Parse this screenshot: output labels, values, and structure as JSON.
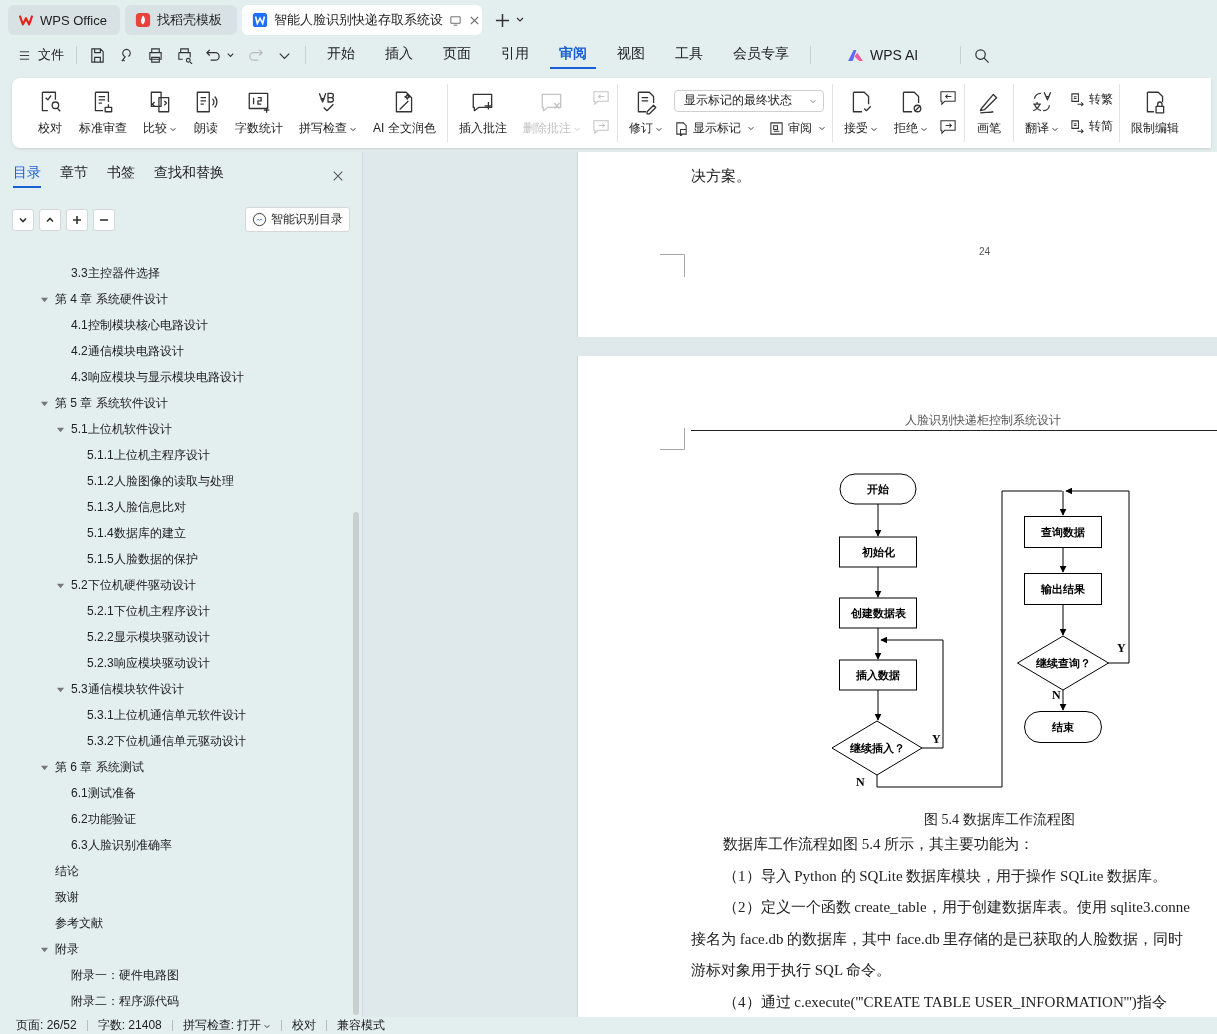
{
  "tabs": [
    {
      "label": "WPS Office",
      "selected": false
    },
    {
      "label": "找稻壳模板",
      "selected": false
    },
    {
      "label": "智能人脸识别快递存取系统设",
      "selected": true
    }
  ],
  "menu": {
    "file": "文件",
    "ai": "WPS AI",
    "tabs": [
      {
        "label": "开始",
        "selected": false
      },
      {
        "label": "插入",
        "selected": false
      },
      {
        "label": "页面",
        "selected": false
      },
      {
        "label": "引用",
        "selected": false
      },
      {
        "label": "审阅",
        "selected": true
      },
      {
        "label": "视图",
        "selected": false
      },
      {
        "label": "工具",
        "selected": false
      },
      {
        "label": "会员专享",
        "selected": false
      }
    ]
  },
  "ribbon": [
    {
      "items": [
        {
          "kind": "large",
          "label": "校对",
          "dropdown": false,
          "disabled": false
        },
        {
          "kind": "large",
          "label": "标准审查",
          "dropdown": false,
          "disabled": false
        },
        {
          "kind": "large",
          "label": "比较",
          "dropdown": true,
          "disabled": false
        },
        {
          "kind": "large",
          "label": "朗读",
          "dropdown": false,
          "disabled": false
        },
        {
          "kind": "large",
          "label": "字数统计",
          "dropdown": false,
          "disabled": false
        },
        {
          "kind": "large",
          "label": "拼写检查",
          "dropdown": true,
          "disabled": false
        },
        {
          "kind": "large",
          "label": "AI 全文润色",
          "dropdown": false,
          "disabled": false
        }
      ]
    },
    {
      "items": [
        {
          "kind": "large",
          "label": "插入批注",
          "dropdown": false,
          "disabled": false
        },
        {
          "kind": "large",
          "label": "删除批注",
          "dropdown": true,
          "disabled": true
        },
        {
          "kind": "icon-pair",
          "disabled": true
        }
      ]
    },
    {
      "items": [
        {
          "kind": "large",
          "label": "修订",
          "dropdown": true,
          "disabled": false
        },
        {
          "kind": "select-block",
          "value": "显示标记的最终状态",
          "buttons": [
            {
              "label": "显示标记",
              "dropdown": true
            },
            {
              "label": "审阅",
              "dropdown": true
            }
          ]
        }
      ]
    },
    {
      "items": [
        {
          "kind": "large",
          "label": "接受",
          "dropdown": true,
          "disabled": false
        },
        {
          "kind": "large",
          "label": "拒绝",
          "dropdown": true,
          "disabled": false
        },
        {
          "kind": "icon-pair",
          "disabled": false
        }
      ]
    },
    {
      "items": [
        {
          "kind": "large",
          "label": "画笔",
          "dropdown": false,
          "disabled": false
        }
      ]
    },
    {
      "items": [
        {
          "kind": "large",
          "label": "翻译",
          "dropdown": true,
          "disabled": false
        },
        {
          "kind": "text-pair",
          "buttons": [
            {
              "label": "转繁"
            },
            {
              "label": "转简"
            }
          ]
        }
      ]
    },
    {
      "items": [
        {
          "kind": "large",
          "label": "限制编辑",
          "dropdown": false,
          "disabled": false
        }
      ]
    }
  ],
  "sidebar": {
    "tabs": [
      {
        "label": "目录",
        "selected": true
      },
      {
        "label": "章节",
        "selected": false
      },
      {
        "label": "书签",
        "selected": false
      },
      {
        "label": "查找和替换",
        "selected": false
      }
    ],
    "smart_button": "智能识别目录",
    "toc": [
      {
        "label": "3.3主控器件选择",
        "kind": "continued"
      },
      {
        "label": "第 4 章 系统硬件设计",
        "kind": "entry",
        "expanded": true,
        "children": [
          {
            "label": "4.1控制模块核心电路设计"
          },
          {
            "label": "4.2通信模块电路设计"
          },
          {
            "label": "4.3响应模块与显示模块电路设计"
          }
        ]
      },
      {
        "label": "第 5 章 系统软件设计",
        "kind": "entry",
        "expanded": true,
        "children": [
          {
            "label": "5.1上位机软件设计",
            "expanded": true,
            "children": [
              {
                "label": "5.1.1上位机主程序设计"
              },
              {
                "label": "5.1.2人脸图像的读取与处理"
              },
              {
                "label": "5.1.3人脸信息比对"
              },
              {
                "label": "5.1.4数据库的建立"
              },
              {
                "label": "5.1.5人脸数据的保护"
              }
            ]
          },
          {
            "label": "5.2下位机硬件驱动设计",
            "expanded": true,
            "children": [
              {
                "label": "5.2.1下位机主程序设计"
              },
              {
                "label": "5.2.2显示模块驱动设计"
              },
              {
                "label": "5.2.3响应模块驱动设计"
              }
            ]
          },
          {
            "label": "5.3通信模块软件设计",
            "expanded": true,
            "children": [
              {
                "label": "5.3.1上位机通信单元软件设计"
              },
              {
                "label": "5.3.2下位机通信单元驱动设计"
              }
            ]
          }
        ]
      },
      {
        "label": "第 6 章 系统测试",
        "kind": "entry",
        "expanded": true,
        "children": [
          {
            "label": "6.1测试准备"
          },
          {
            "label": "6.2功能验证"
          },
          {
            "label": "6.3人脸识别准确率"
          }
        ]
      },
      {
        "label": "结论",
        "kind": "entry"
      },
      {
        "label": "致谢",
        "kind": "entry"
      },
      {
        "label": "参考文献",
        "kind": "entry"
      },
      {
        "label": "附录",
        "kind": "entry",
        "expanded": true,
        "children": [
          {
            "label": "附录一：硬件电路图"
          },
          {
            "label": "附录二：程序源代码"
          }
        ]
      }
    ]
  },
  "document": {
    "page_top": {
      "text": "决方案。",
      "page_number": "24"
    },
    "page": {
      "header": "人脸识别快递柜控制系统设计",
      "flowchart": {
        "nodes": [
          {
            "kind": "terminal",
            "label": "开始"
          },
          {
            "kind": "process",
            "label": "初始化"
          },
          {
            "kind": "process",
            "label": "创建数据表"
          },
          {
            "kind": "process",
            "label": "插入数据"
          },
          {
            "kind": "decision",
            "label": "继续插入？"
          },
          {
            "kind": "process",
            "label": "查询数据"
          },
          {
            "kind": "process",
            "label": "输出结果"
          },
          {
            "kind": "decision",
            "label": "继续查询？"
          },
          {
            "kind": "terminal",
            "label": "结束"
          }
        ],
        "branch_labels": [
          "Y",
          "N",
          "Y",
          "N"
        ]
      },
      "caption": "图 5.4 数据库工作流程图",
      "lines": [
        {
          "kind": "indent",
          "text": "数据库工作流程如图 5.4 所示，其主要功能为："
        },
        {
          "kind": "indent",
          "text": "（1）导入 Python 的 SQLite 数据库模块，用于操作 SQLite 数据库。"
        },
        {
          "kind": "indent",
          "text": "（2）定义一个函数 create_table，用于创建数据库表。使用 sqlite3.conne"
        },
        {
          "kind": "plain",
          "text": "接名为 face.db 的数据库，其中 face.db 里存储的是已获取的人脸数据，同时"
        },
        {
          "kind": "plain",
          "text": "游标对象用于执行 SQL 命令。"
        },
        {
          "kind": "indent",
          "text": "（4）通过 c.execute('''CREATE TABLE USER_INFORMATION''')指令"
        }
      ]
    }
  },
  "status_bar": {
    "page": "页面: 26/52",
    "words": "字数: 21408",
    "spell": "拼写检查: 打开",
    "proofread": "校对",
    "mode": "兼容模式"
  }
}
